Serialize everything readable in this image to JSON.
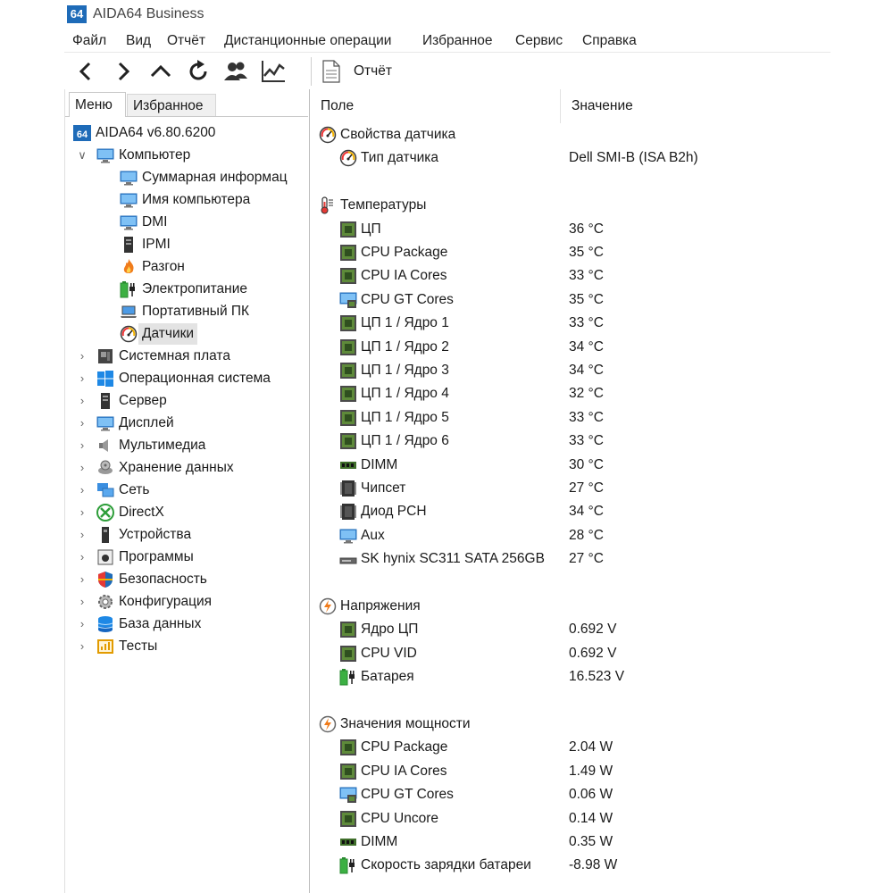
{
  "window": {
    "logo": "64",
    "title": "AIDA64 Business"
  },
  "menu": [
    "Файл",
    "Вид",
    "Отчёт",
    "Дистанционные операции",
    "Избранное",
    "Сервис",
    "Справка"
  ],
  "toolbar": {
    "buttons": [
      "back-icon",
      "forward-icon",
      "up-icon",
      "refresh-icon",
      "users-icon",
      "chart-icon"
    ],
    "report_label": "Отчёт"
  },
  "left": {
    "tabs": [
      "Меню",
      "Избранное"
    ],
    "tree": [
      {
        "label": "AIDA64 v6.80.6200",
        "icon": "aida64-logo-icon",
        "level": 0,
        "chevron": ""
      },
      {
        "label": "Компьютер",
        "icon": "computer-icon",
        "level": 0,
        "chevron": "down"
      },
      {
        "label": "Суммарная информац",
        "icon": "monitor-icon",
        "level": 1,
        "chevron": ""
      },
      {
        "label": "Имя компьютера",
        "icon": "monitor-icon",
        "level": 1,
        "chevron": ""
      },
      {
        "label": "DMI",
        "icon": "monitor-icon",
        "level": 1,
        "chevron": ""
      },
      {
        "label": "IPMI",
        "icon": "server-icon",
        "level": 1,
        "chevron": ""
      },
      {
        "label": "Разгон",
        "icon": "flame-icon",
        "level": 1,
        "chevron": ""
      },
      {
        "label": "Электропитание",
        "icon": "battery-plug-icon",
        "level": 1,
        "chevron": ""
      },
      {
        "label": "Портативный ПК",
        "icon": "laptop-icon",
        "level": 1,
        "chevron": ""
      },
      {
        "label": "Датчики",
        "icon": "gauge-icon",
        "level": 1,
        "chevron": "",
        "selected": true
      },
      {
        "label": "Системная плата",
        "icon": "motherboard-icon",
        "level": 0,
        "chevron": "right"
      },
      {
        "label": "Операционная система",
        "icon": "windows-icon",
        "level": 0,
        "chevron": "right"
      },
      {
        "label": "Сервер",
        "icon": "server-icon",
        "level": 0,
        "chevron": "right"
      },
      {
        "label": "Дисплей",
        "icon": "display-icon",
        "level": 0,
        "chevron": "right"
      },
      {
        "label": "Мультимедиа",
        "icon": "speaker-icon",
        "level": 0,
        "chevron": "right"
      },
      {
        "label": "Хранение данных",
        "icon": "storage-icon",
        "level": 0,
        "chevron": "right"
      },
      {
        "label": "Сеть",
        "icon": "network-icon",
        "level": 0,
        "chevron": "right"
      },
      {
        "label": "DirectX",
        "icon": "xbox-icon",
        "level": 0,
        "chevron": "right"
      },
      {
        "label": "Устройства",
        "icon": "device-icon",
        "level": 0,
        "chevron": "right"
      },
      {
        "label": "Программы",
        "icon": "programs-icon",
        "level": 0,
        "chevron": "right"
      },
      {
        "label": "Безопасность",
        "icon": "shield-icon",
        "level": 0,
        "chevron": "right"
      },
      {
        "label": "Конфигурация",
        "icon": "config-icon",
        "level": 0,
        "chevron": "right"
      },
      {
        "label": "База данных",
        "icon": "database-icon",
        "level": 0,
        "chevron": "right"
      },
      {
        "label": "Тесты",
        "icon": "benchmark-icon",
        "level": 0,
        "chevron": "right"
      }
    ]
  },
  "right": {
    "headers": {
      "field": "Поле",
      "value": "Значение"
    },
    "sections": [
      {
        "title": "Свойства датчика",
        "icon": "gauge-icon",
        "items": [
          {
            "label": "Тип датчика",
            "icon": "gauge-icon",
            "value": "Dell SMI-B  (ISA B2h)"
          }
        ]
      },
      {
        "title": "Температуры",
        "icon": "thermometer-icon",
        "items": [
          {
            "label": "ЦП",
            "icon": "cpu-icon",
            "value": "36 °C"
          },
          {
            "label": "CPU Package",
            "icon": "cpu-icon",
            "value": "35 °C"
          },
          {
            "label": "CPU IA Cores",
            "icon": "cpu-icon",
            "value": "33 °C"
          },
          {
            "label": "CPU GT Cores",
            "icon": "gpu-icon",
            "value": "35 °C"
          },
          {
            "label": "ЦП 1 / Ядро 1",
            "icon": "cpu-icon",
            "value": "33 °C"
          },
          {
            "label": "ЦП 1 / Ядро 2",
            "icon": "cpu-icon",
            "value": "34 °C"
          },
          {
            "label": "ЦП 1 / Ядро 3",
            "icon": "cpu-icon",
            "value": "34 °C"
          },
          {
            "label": "ЦП 1 / Ядро 4",
            "icon": "cpu-icon",
            "value": "32 °C"
          },
          {
            "label": "ЦП 1 / Ядро 5",
            "icon": "cpu-icon",
            "value": "33 °C"
          },
          {
            "label": "ЦП 1 / Ядро 6",
            "icon": "cpu-icon",
            "value": "33 °C"
          },
          {
            "label": "DIMM",
            "icon": "ram-icon",
            "value": "30 °C"
          },
          {
            "label": "Чипсет",
            "icon": "chip-icon",
            "value": "27 °C"
          },
          {
            "label": "Диод PCH",
            "icon": "chip-icon",
            "value": "34 °C"
          },
          {
            "label": "Aux",
            "icon": "monitor-icon",
            "value": "28 °C"
          },
          {
            "label": "SK hynix SC311 SATA 256GB",
            "icon": "drive-icon",
            "value": "27 °C"
          }
        ]
      },
      {
        "title": "Напряжения",
        "icon": "voltage-icon",
        "items": [
          {
            "label": "Ядро ЦП",
            "icon": "cpu-icon",
            "value": "0.692 V"
          },
          {
            "label": "CPU VID",
            "icon": "cpu-icon",
            "value": "0.692 V"
          },
          {
            "label": "Батарея",
            "icon": "battery-plug-icon",
            "value": "16.523 V"
          }
        ]
      },
      {
        "title": "Значения мощности",
        "icon": "voltage-icon",
        "items": [
          {
            "label": "CPU Package",
            "icon": "cpu-icon",
            "value": "2.04 W"
          },
          {
            "label": "CPU IA Cores",
            "icon": "cpu-icon",
            "value": "1.49 W"
          },
          {
            "label": "CPU GT Cores",
            "icon": "gpu-icon",
            "value": "0.06 W"
          },
          {
            "label": "CPU Uncore",
            "icon": "cpu-icon",
            "value": "0.14 W"
          },
          {
            "label": "DIMM",
            "icon": "ram-icon",
            "value": "0.35 W"
          },
          {
            "label": "Скорость зарядки батареи",
            "icon": "battery-plug-icon",
            "value": "-8.98 W"
          }
        ]
      }
    ]
  }
}
